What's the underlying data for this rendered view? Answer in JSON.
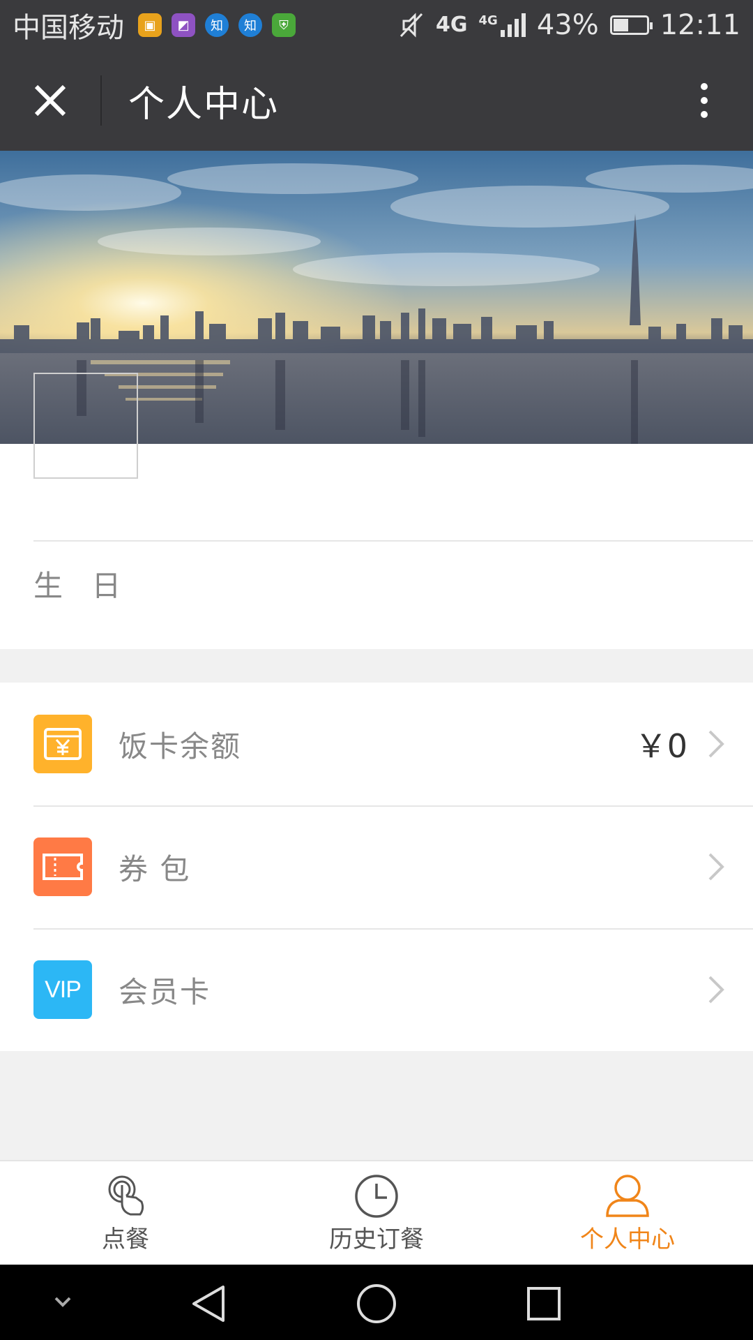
{
  "status_bar": {
    "carrier": "中国移动",
    "app_icons": [
      "wallet-icon",
      "gallery-icon",
      "zhihu-icon",
      "zhihu-icon",
      "shield-icon"
    ],
    "zhihu_glyph": "知",
    "network_main": "4G",
    "network_small": "4G",
    "battery": "43%",
    "battery_level": 0.43,
    "time": "12:11"
  },
  "title_bar": {
    "title": "个人中心"
  },
  "profile": {
    "birthday_label": "生 日"
  },
  "menu": {
    "items": [
      {
        "label": "饭卡余额",
        "value": "￥0",
        "icon": "meal-card-icon",
        "color": "#ffb22b"
      },
      {
        "label": "券 包",
        "value": "",
        "icon": "coupon-icon",
        "color": "#ff7a45"
      },
      {
        "label": "会员卡",
        "value": "",
        "icon": "vip-icon",
        "icon_text": "VIP",
        "color": "#2cb7f5"
      }
    ]
  },
  "tabs": [
    {
      "label": "点餐",
      "icon": "tap-order-icon",
      "active": false
    },
    {
      "label": "历史订餐",
      "icon": "clock-icon",
      "active": false
    },
    {
      "label": "个人中心",
      "icon": "user-icon",
      "active": true
    }
  ],
  "colors": {
    "header_bg": "#3a3a3d",
    "accent": "#f08519",
    "page_bg": "#f1f1f1"
  }
}
